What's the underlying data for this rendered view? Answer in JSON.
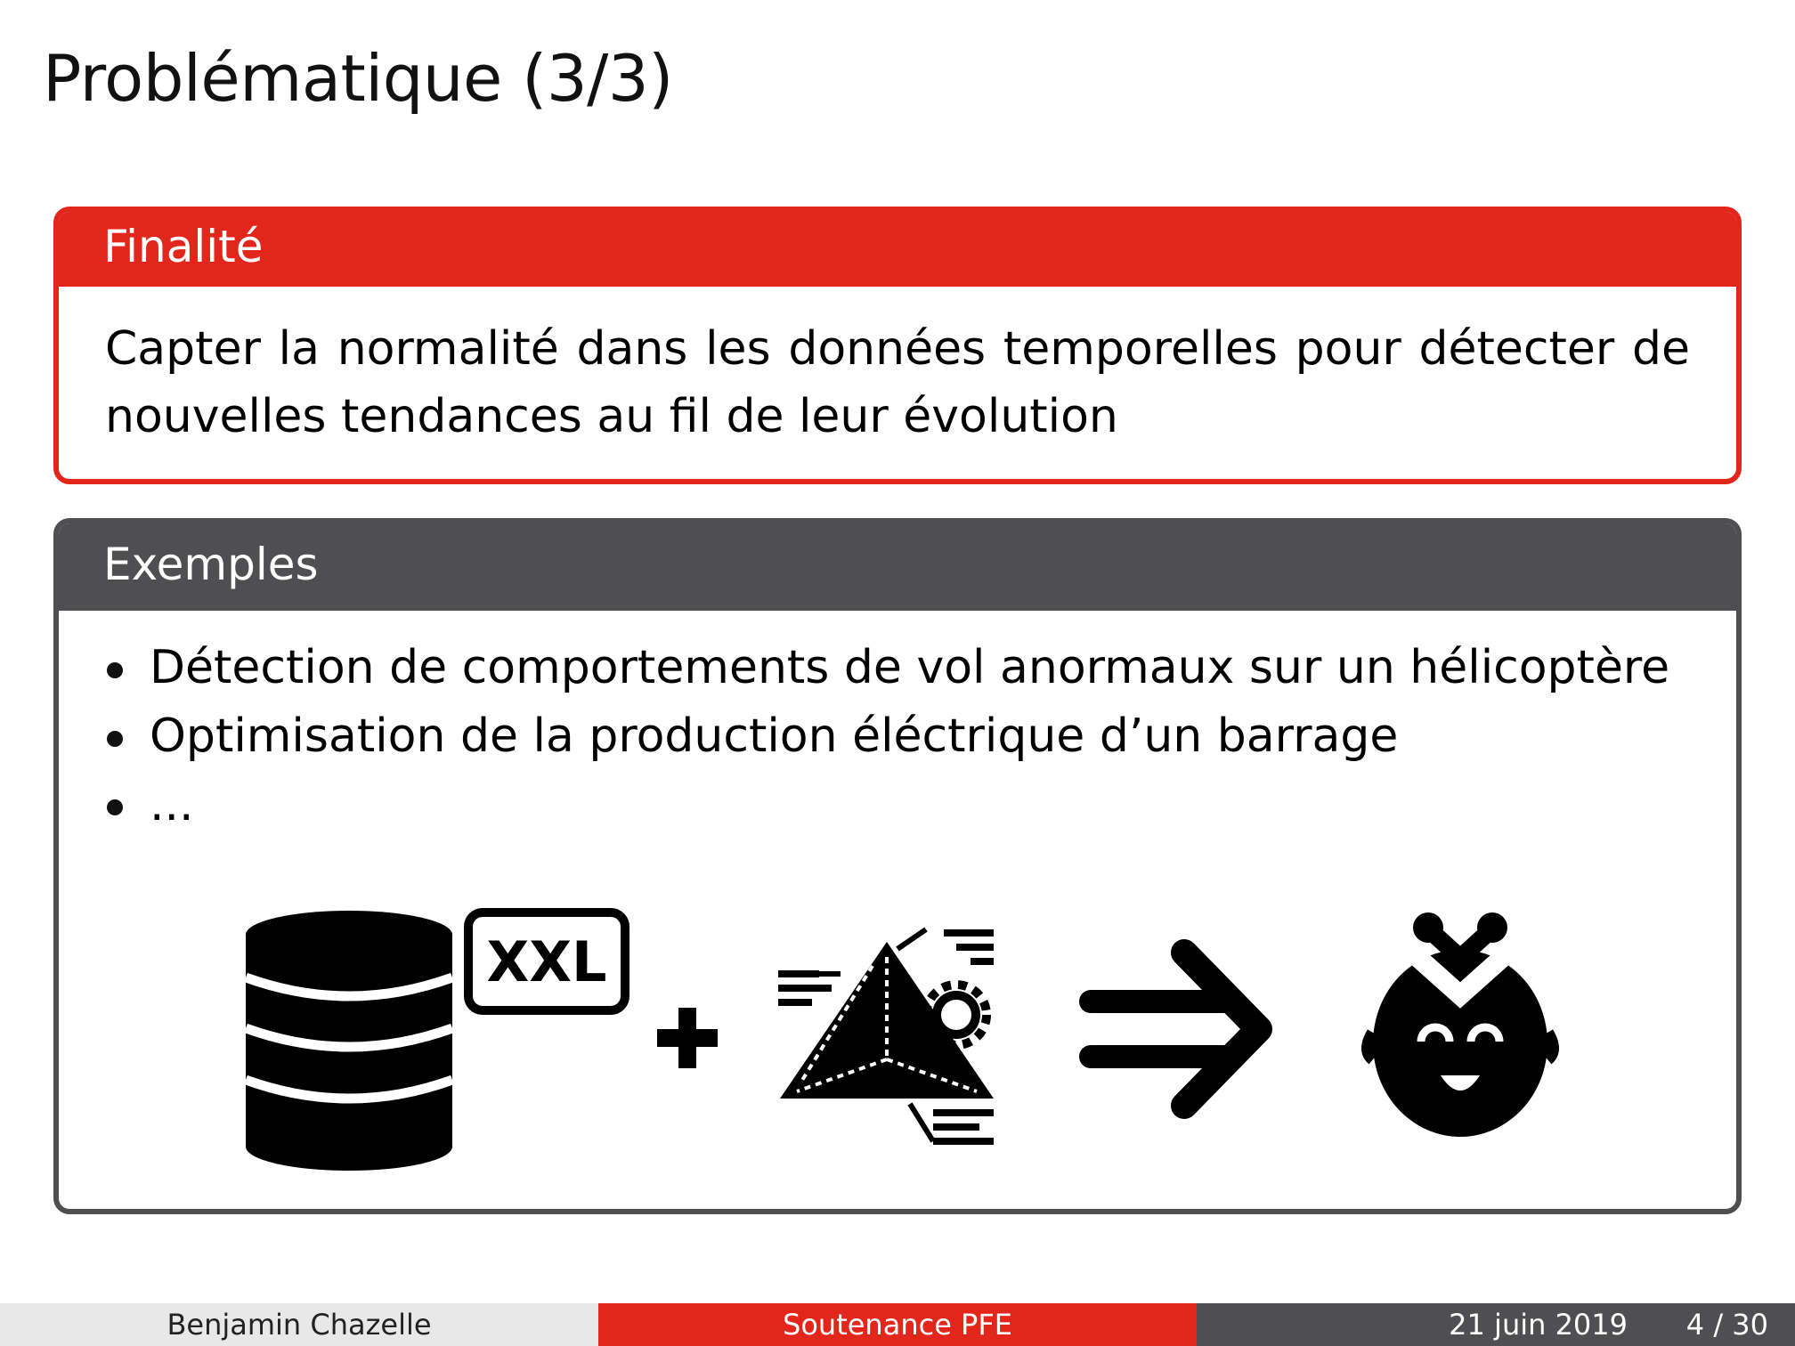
{
  "frame": {
    "title": "Problématique (3/3)"
  },
  "blocks": {
    "finalite": {
      "title": "Finalité",
      "body": "Capter la normalité dans les données temporelles pour détecter de nouvelles tendances au fil de leur évolution"
    },
    "exemples": {
      "title": "Exemples",
      "items": [
        "Détection de comportements de vol anormaux sur un hélicoptère",
        "Optimisation de la production éléctrique d’un barrage",
        "..."
      ]
    }
  },
  "icons": {
    "database": "database-icon",
    "xxl_label": "XXL",
    "plus": "plus-icon",
    "model": "pyramid-model-icon",
    "arrow": "arrow-right-icon",
    "face": "happy-face-with-heart-icon"
  },
  "footer": {
    "author": "Benjamin Chazelle",
    "event": "Soutenance PFE",
    "date": "21 juin 2019",
    "page": "4 / 30"
  },
  "colors": {
    "accent_red": "#e2261b",
    "block_gray": "#4f4e51",
    "footer_light": "#e8e8e8"
  }
}
